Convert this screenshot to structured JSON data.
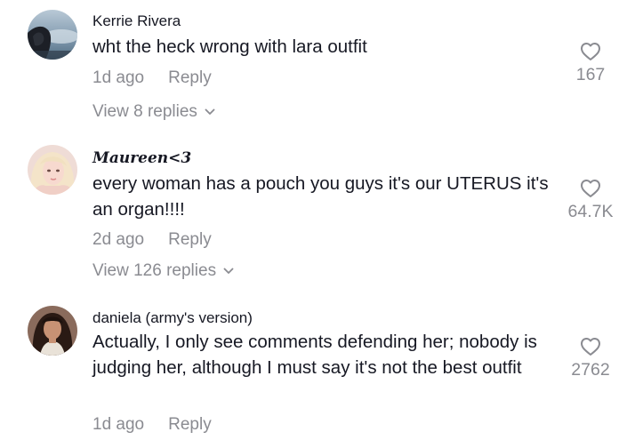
{
  "comments": [
    {
      "username": "Kerrie Rivera",
      "text": "wht the heck wrong with lara outfit",
      "time": "1d ago",
      "reply_label": "Reply",
      "view_replies": "View 8 replies",
      "likes": "167",
      "avatar_icon": "avatar-photo"
    },
    {
      "username": "Maureen<3",
      "text": "every woman has a pouch you guys it's our UTERUS it's an organ!!!!",
      "time": "2d ago",
      "reply_label": "Reply",
      "view_replies": "View 126 replies",
      "likes": "64.7K",
      "avatar_icon": "avatar-photo"
    },
    {
      "username": "daniela (army's version)",
      "text": "Actually, I only see comments defending her; nobody is judging her, although I must say it's not the best outfit",
      "time": "1d ago",
      "reply_label": "Reply",
      "likes": "2762",
      "avatar_icon": "avatar-photo"
    }
  ],
  "icons": {
    "like": "heart-outline-icon",
    "expand": "chevron-down-icon"
  },
  "colors": {
    "primary_text": "#161823",
    "secondary_text": "#8a8b91",
    "background": "#ffffff"
  }
}
